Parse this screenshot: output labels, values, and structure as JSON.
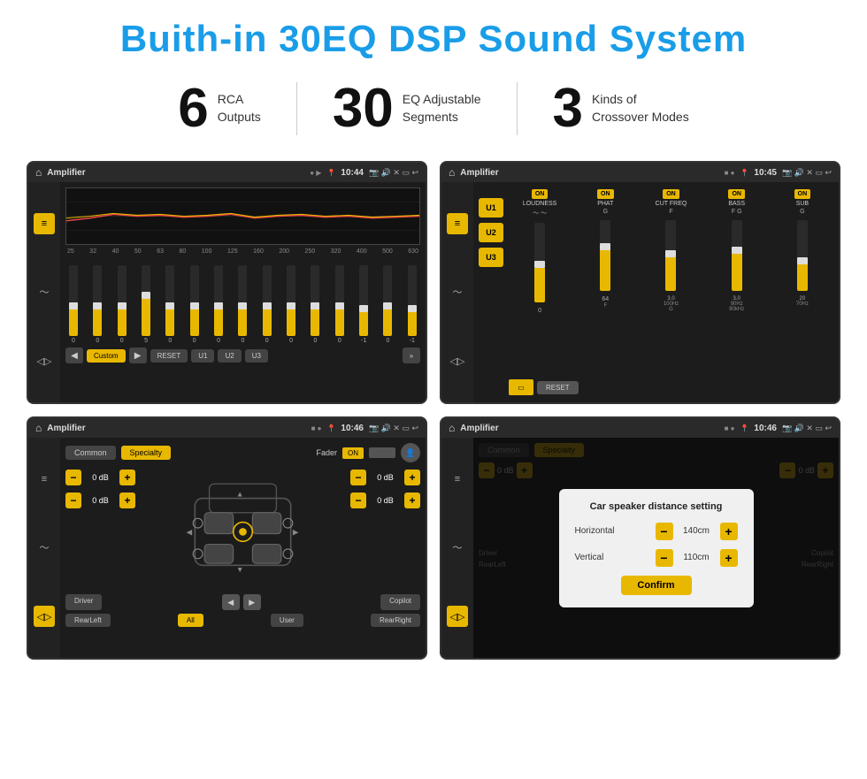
{
  "title": "Buith-in 30EQ DSP Sound System",
  "stats": [
    {
      "number": "6",
      "line1": "RCA",
      "line2": "Outputs"
    },
    {
      "number": "30",
      "line1": "EQ Adjustable",
      "line2": "Segments"
    },
    {
      "number": "3",
      "line1": "Kinds of",
      "line2": "Crossover Modes"
    }
  ],
  "screens": [
    {
      "id": "eq-screen",
      "topbar": {
        "title": "Amplifier",
        "time": "10:44"
      },
      "type": "eq"
    },
    {
      "id": "crossover-screen",
      "topbar": {
        "title": "Amplifier",
        "time": "10:45"
      },
      "type": "crossover"
    },
    {
      "id": "fader-screen",
      "topbar": {
        "title": "Amplifier",
        "time": "10:46"
      },
      "type": "fader"
    },
    {
      "id": "dialog-screen",
      "topbar": {
        "title": "Amplifier",
        "time": "10:46"
      },
      "type": "dialog"
    }
  ],
  "eq": {
    "freqs": [
      "25",
      "32",
      "40",
      "50",
      "63",
      "80",
      "100",
      "125",
      "160",
      "200",
      "250",
      "320",
      "400",
      "500",
      "630"
    ],
    "values": [
      "0",
      "0",
      "0",
      "5",
      "0",
      "0",
      "0",
      "0",
      "0",
      "0",
      "0",
      "0",
      "-1",
      "0",
      "-1"
    ],
    "buttons": [
      "Custom",
      "RESET",
      "U1",
      "U2",
      "U3"
    ]
  },
  "crossover": {
    "presets": [
      "U1",
      "U2",
      "U3"
    ],
    "channels": [
      {
        "label": "LOUDNESS",
        "on": true
      },
      {
        "label": "PHAT",
        "on": true
      },
      {
        "label": "CUT FREQ",
        "on": true
      },
      {
        "label": "BASS",
        "on": true
      },
      {
        "label": "SUB",
        "on": true
      }
    ],
    "reset": "RESET"
  },
  "fader": {
    "tabs": [
      "Common",
      "Specialty"
    ],
    "label": "Fader",
    "on": "ON",
    "channels": [
      "Driver",
      "RearLeft",
      "All",
      "User",
      "RearRight",
      "Copilot"
    ],
    "dbValues": [
      "0 dB",
      "0 dB",
      "0 dB",
      "0 dB"
    ]
  },
  "dialog": {
    "title": "Car speaker distance setting",
    "horizontal": {
      "label": "Horizontal",
      "value": "140cm"
    },
    "vertical": {
      "label": "Vertical",
      "value": "110cm"
    },
    "confirm": "Confirm",
    "tabs": [
      "Common",
      "Specialty"
    ],
    "dbValues": [
      "0 dB",
      "0 dB"
    ]
  }
}
